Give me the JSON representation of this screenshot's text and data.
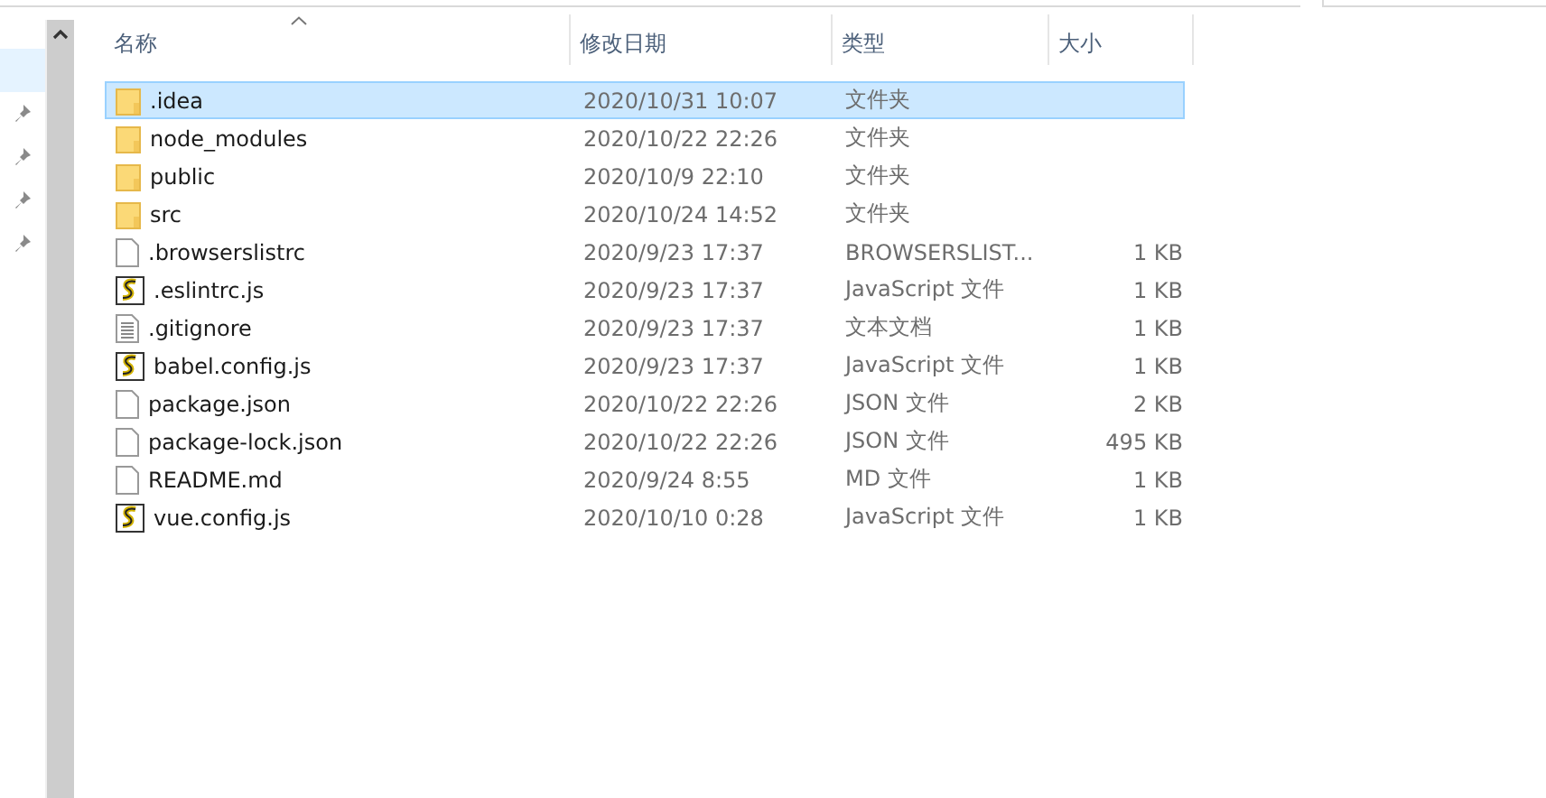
{
  "columns": [
    {
      "label": "名称",
      "sorted": true
    },
    {
      "label": "修改日期",
      "sorted": false
    },
    {
      "label": "类型",
      "sorted": false
    },
    {
      "label": "大小",
      "sorted": false
    }
  ],
  "nav_pins": [
    {
      "selected": true,
      "pinned": false
    },
    {
      "selected": false,
      "pinned": true
    },
    {
      "selected": false,
      "pinned": true
    },
    {
      "selected": false,
      "pinned": true
    },
    {
      "selected": false,
      "pinned": true
    }
  ],
  "rows": [
    {
      "kind": "folder",
      "name": ".idea",
      "modified": "2020/10/31 10:07",
      "type": "文件夹",
      "size": "",
      "selected": true
    },
    {
      "kind": "folder",
      "name": "node_modules",
      "modified": "2020/10/22 22:26",
      "type": "文件夹",
      "size": "",
      "selected": false
    },
    {
      "kind": "folder",
      "name": "public",
      "modified": "2020/10/9 22:10",
      "type": "文件夹",
      "size": "",
      "selected": false
    },
    {
      "kind": "folder",
      "name": "src",
      "modified": "2020/10/24 14:52",
      "type": "文件夹",
      "size": "",
      "selected": false
    },
    {
      "kind": "file",
      "name": ".browserslistrc",
      "modified": "2020/9/23 17:37",
      "type": "BROWSERSLIST...",
      "size": "1 KB",
      "selected": false
    },
    {
      "kind": "script",
      "name": ".eslintrc.js",
      "modified": "2020/9/23 17:37",
      "type": "JavaScript 文件",
      "size": "1 KB",
      "selected": false
    },
    {
      "kind": "text",
      "name": ".gitignore",
      "modified": "2020/9/23 17:37",
      "type": "文本文档",
      "size": "1 KB",
      "selected": false
    },
    {
      "kind": "script",
      "name": "babel.config.js",
      "modified": "2020/9/23 17:37",
      "type": "JavaScript 文件",
      "size": "1 KB",
      "selected": false
    },
    {
      "kind": "file",
      "name": "package.json",
      "modified": "2020/10/22 22:26",
      "type": "JSON 文件",
      "size": "2 KB",
      "selected": false
    },
    {
      "kind": "file",
      "name": "package-lock.json",
      "modified": "2020/10/22 22:26",
      "type": "JSON 文件",
      "size": "495 KB",
      "selected": false
    },
    {
      "kind": "file",
      "name": "README.md",
      "modified": "2020/9/24 8:55",
      "type": "MD 文件",
      "size": "1 KB",
      "selected": false
    },
    {
      "kind": "script",
      "name": "vue.config.js",
      "modified": "2020/10/10 0:28",
      "type": "JavaScript 文件",
      "size": "1 KB",
      "selected": false
    }
  ]
}
